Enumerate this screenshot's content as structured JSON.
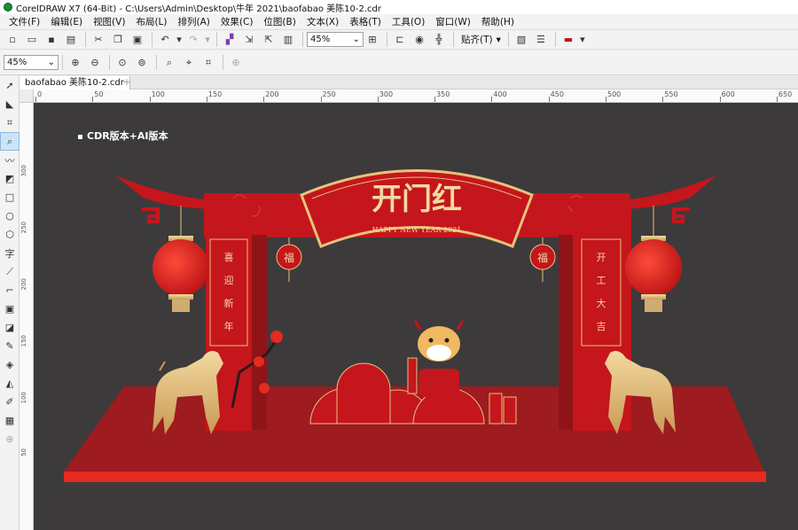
{
  "window": {
    "title": "CorelDRAW X7 (64-Bit) - C:\\Users\\Admin\\Desktop\\牛年 2021\\baofabao 美陈10-2.cdr"
  },
  "menu": [
    "文件(F)",
    "编辑(E)",
    "视图(V)",
    "布局(L)",
    "排列(A)",
    "效果(C)",
    "位图(B)",
    "文本(X)",
    "表格(T)",
    "工具(O)",
    "窗口(W)",
    "帮助(H)"
  ],
  "toolbar": {
    "zoom_value": "45%",
    "snap_label": "贴齐(T)"
  },
  "property_bar": {
    "zoom_value": "45%"
  },
  "document_tab": {
    "label": "baofabao 美陈10-2.cdr"
  },
  "ruler": {
    "h_ticks": [
      "0",
      "50",
      "100",
      "150",
      "200",
      "250",
      "300",
      "350",
      "400",
      "450",
      "500",
      "550",
      "600",
      "650"
    ],
    "v_ticks": [
      "300",
      "250",
      "200",
      "150",
      "100",
      "50"
    ]
  },
  "artwork": {
    "caption": "CDR版本+AI版本",
    "arch_title": "开门红",
    "arch_subtitle": "HAPPY NEW YEAR 2021",
    "left_couplet": [
      "喜",
      "迎",
      "新",
      "年"
    ],
    "right_couplet": [
      "开",
      "工",
      "大",
      "吉"
    ],
    "fu": "福",
    "colors": {
      "red": "#c4161c",
      "dark_red": "#9e1b1f",
      "gold": "#e7c27d",
      "canvas": "#3d3a3b"
    }
  }
}
